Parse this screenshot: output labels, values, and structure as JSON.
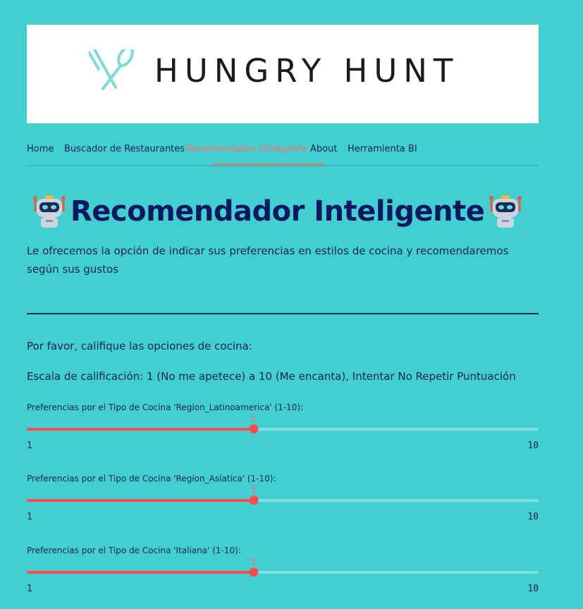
{
  "banner": {
    "logo_text": "HUNGRY HUNT"
  },
  "nav": {
    "items": [
      {
        "label": "Home"
      },
      {
        "label": "Buscador de Restaurantes"
      },
      {
        "label": "Recomendador Inteligente",
        "active": true
      },
      {
        "label": "About"
      },
      {
        "label": "Herramienta BI"
      }
    ]
  },
  "page": {
    "title": "Recomendador Inteligente",
    "title_icon": "robot-icon",
    "intro": "Le ofrecemos la opción de indicar sus preferencias en estilos de cocina y recomendaremos según sus gustos",
    "prompt": "Por favor, califique las opciones de cocina:",
    "scale": "Escala de calificación: 1 (No me apetece) a 10 (Me encanta), Intentar No Repetir Puntuación"
  },
  "sliders": [
    {
      "label": "Preferencias por el Tipo de Cocina 'Region_Latinoamerica' (1-10):",
      "value": "5",
      "min": "1",
      "max": "10"
    },
    {
      "label": "Preferencias por el Tipo de Cocina 'Region_Asiatica' (1-10):",
      "value": "5",
      "min": "1",
      "max": "10"
    },
    {
      "label": "Preferencias por el Tipo de Cocina 'Italiana' (1-10):",
      "value": "5",
      "min": "1",
      "max": "10"
    }
  ],
  "colors": {
    "background": "#41cfcf",
    "accent": "#ff4b4b",
    "title": "#0f1662"
  }
}
